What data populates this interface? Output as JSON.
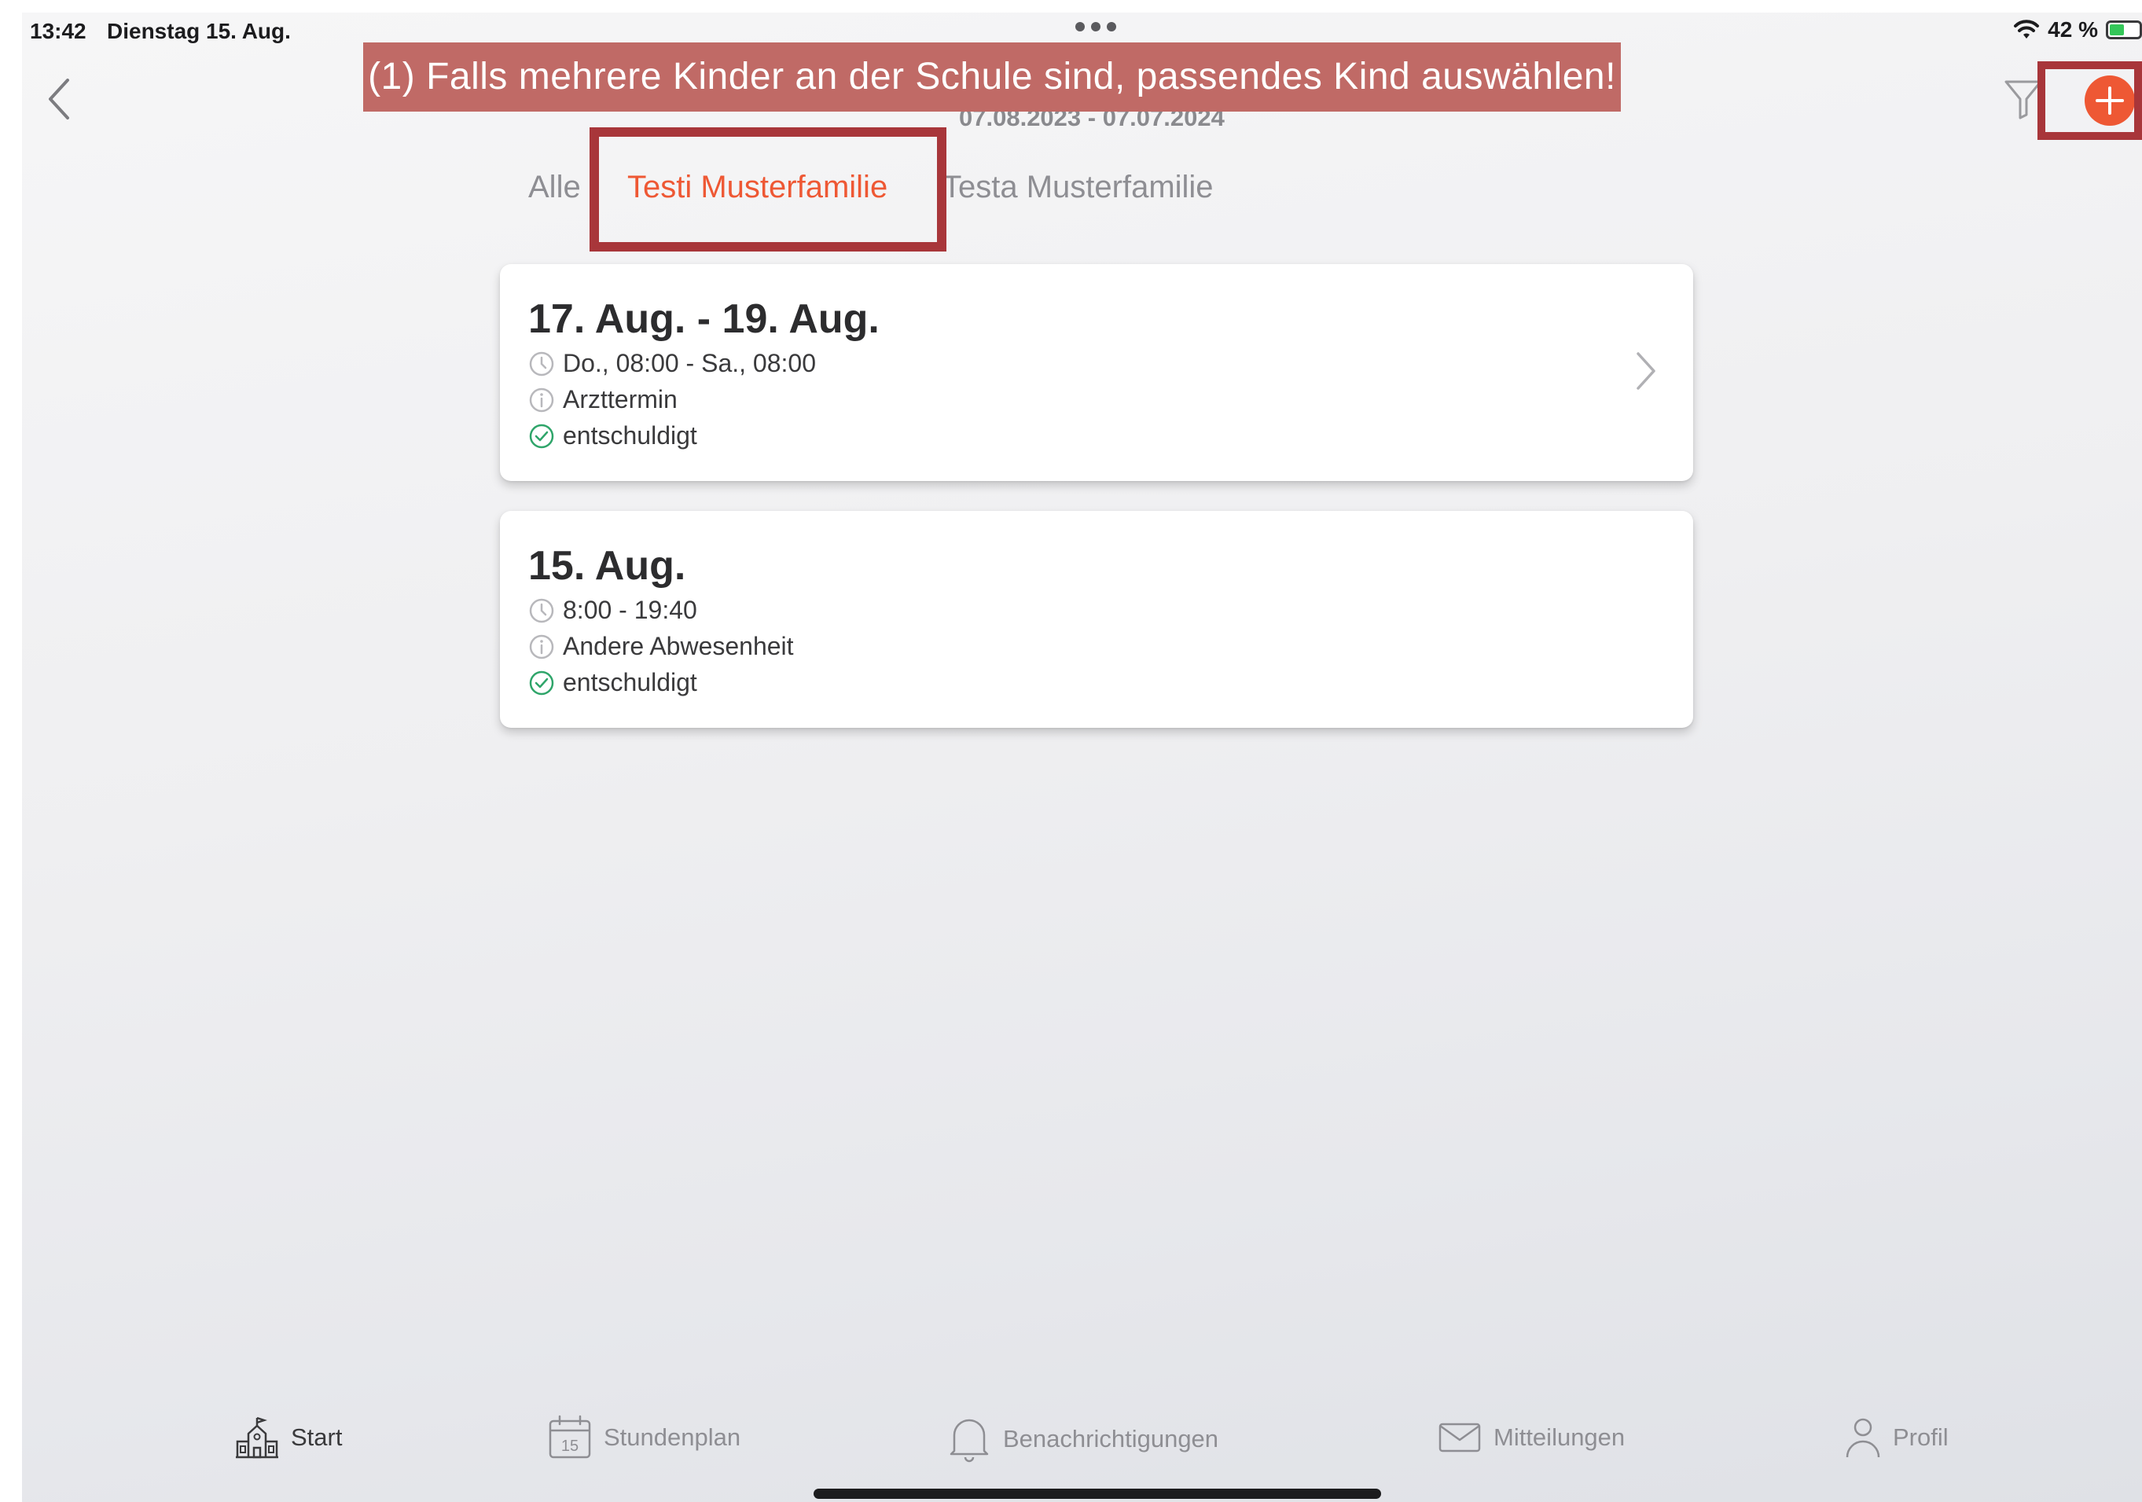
{
  "status_bar": {
    "time": "13:42",
    "date": "Dienstag 15. Aug.",
    "battery": "42 %"
  },
  "annotation": {
    "text": "(1) Falls mehrere Kinder an der Schule sind, passendes Kind auswählen!"
  },
  "header": {
    "period": "07.08.2023 - 07.07.2024"
  },
  "tabs": [
    {
      "label": "Alle"
    },
    {
      "label": "Testi Musterfamilie"
    },
    {
      "label": "Testa Musterfamilie"
    }
  ],
  "absences": [
    {
      "title": "17. Aug. - 19. Aug.",
      "time": "Do., 08:00 - Sa., 08:00",
      "reason": "Arzttermin",
      "status": "entschuldigt"
    },
    {
      "title": "15. Aug.",
      "time": "8:00 - 19:40",
      "reason": "Andere Abwesenheit",
      "status": "entschuldigt"
    }
  ],
  "bottom_nav": [
    {
      "label": "Start",
      "icon": "school-icon"
    },
    {
      "label": "Stundenplan",
      "icon": "calendar-icon",
      "calendar_day": "15"
    },
    {
      "label": "Benachrichtigungen",
      "icon": "bell-icon"
    },
    {
      "label": "Mitteilungen",
      "icon": "mail-icon"
    },
    {
      "label": "Profil",
      "icon": "person-icon"
    }
  ],
  "colors": {
    "accent": "#ee5834",
    "highlight_border": "#a8363a",
    "banner_bg": "#c06a66",
    "status_ok": "#2fa56a"
  }
}
